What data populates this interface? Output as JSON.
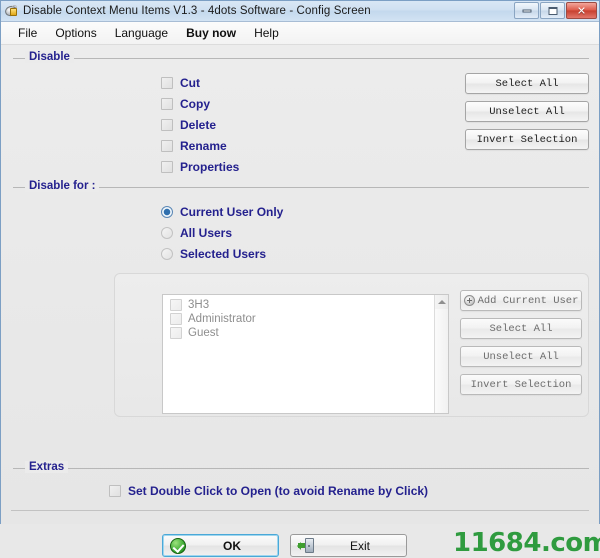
{
  "window": {
    "title": "Disable Context Menu Items V1.3 - 4dots Software - Config Screen",
    "icon": "lock-disc-icon",
    "controls": {
      "minimize": "minimize-icon",
      "maximize": "maximize-icon",
      "close": "✕"
    }
  },
  "menu": {
    "items": [
      {
        "label": "File",
        "bold": false
      },
      {
        "label": "Options",
        "bold": false
      },
      {
        "label": "Language",
        "bold": false
      },
      {
        "label": "Buy now",
        "bold": true
      },
      {
        "label": "Help",
        "bold": false
      }
    ]
  },
  "disable_group": {
    "title": "Disable",
    "checkboxes": [
      {
        "label": "Cut",
        "checked": false
      },
      {
        "label": "Copy",
        "checked": false
      },
      {
        "label": "Delete",
        "checked": false
      },
      {
        "label": "Rename",
        "checked": false
      },
      {
        "label": "Properties",
        "checked": false
      }
    ],
    "buttons": [
      {
        "label": "Select All"
      },
      {
        "label": "Unselect All"
      },
      {
        "label": "Invert Selection"
      }
    ]
  },
  "disable_for_group": {
    "title": "Disable for :",
    "radios": [
      {
        "label": "Current User Only",
        "selected": true
      },
      {
        "label": "All Users",
        "selected": false
      },
      {
        "label": "Selected Users",
        "selected": false
      }
    ],
    "user_list": {
      "items": [
        {
          "label": "3H3",
          "checked": false
        },
        {
          "label": "Administrator",
          "checked": false
        },
        {
          "label": "Guest",
          "checked": false
        }
      ],
      "scrollbar": "vertical-scrollbar"
    },
    "list_buttons": [
      {
        "label": "Add Current User",
        "icon": "plus-icon"
      },
      {
        "label": "Select All",
        "icon": ""
      },
      {
        "label": "Unselect All",
        "icon": ""
      },
      {
        "label": "Invert Selection",
        "icon": ""
      }
    ]
  },
  "extras_group": {
    "title": "Extras",
    "checkbox": {
      "label": "Set Double Click to Open (to avoid Rename by Click)",
      "checked": false
    }
  },
  "footer": {
    "ok": {
      "label": "OK",
      "icon": "green-check-icon"
    },
    "exit": {
      "label": "Exit",
      "icon": "exit-door-icon"
    },
    "watermark": "11684.com"
  },
  "colors": {
    "label_navy": "#24218e",
    "title_blue": "#cfe0f1",
    "close_red": "#c6402f",
    "watermark_green": "#2f9b3f"
  }
}
